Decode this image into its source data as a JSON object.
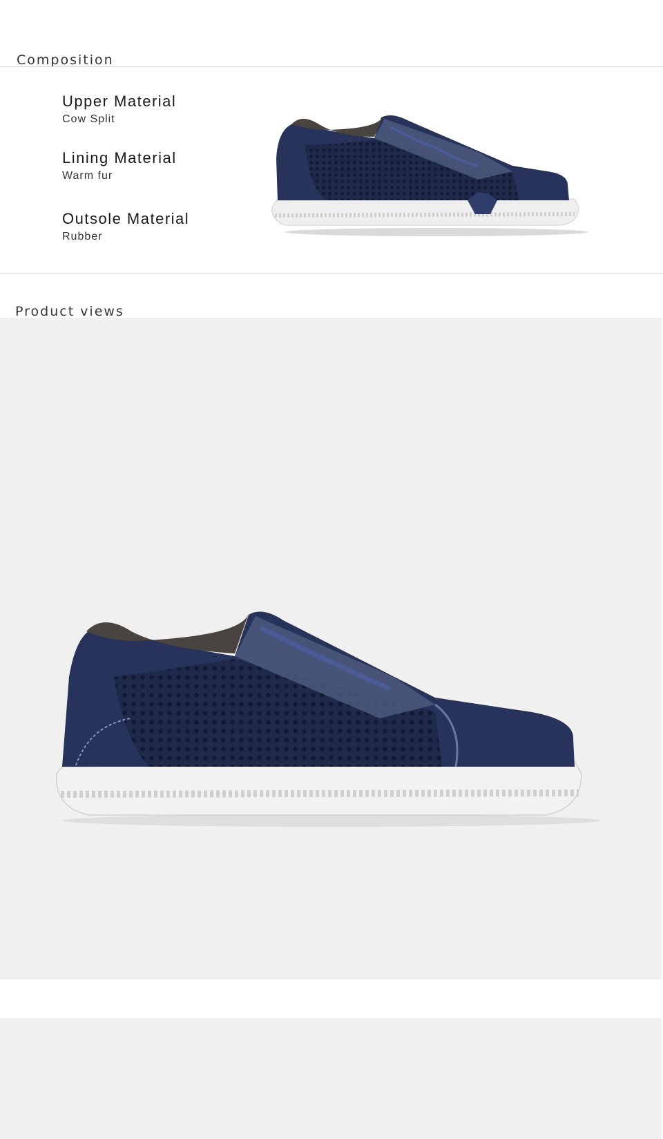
{
  "composition": {
    "title": "Composition",
    "materials": [
      {
        "label": "Upper Material",
        "value": "Cow Split"
      },
      {
        "label": "Lining Material",
        "value": "Warm fur"
      },
      {
        "label": "Outsole Material",
        "value": "Rubber"
      }
    ]
  },
  "product_views": {
    "title": "Product views"
  },
  "colors": {
    "navy": "#27335a",
    "fur": "#4a4440",
    "sole": "#ececec",
    "panel_bg": "#f0f0f0"
  }
}
